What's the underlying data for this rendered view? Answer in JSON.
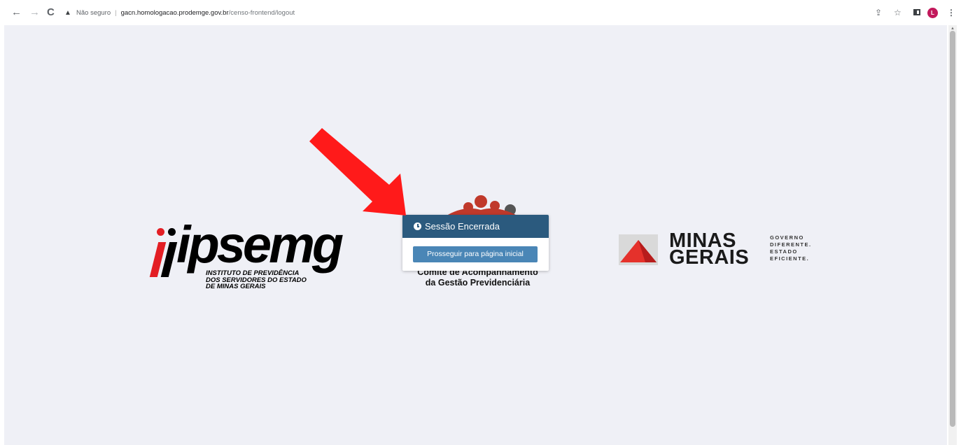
{
  "browser": {
    "security_label": "Não seguro",
    "url_host": "gacn.homologacao.prodemge.gov.br",
    "url_path": "/censo-frontend/logout",
    "profile_initial": "L",
    "profile_color": "#c2185b"
  },
  "ipsemg_logo": {
    "wordmark": "ipsemg",
    "subtitle_line1": "INSTITUTO DE PREVIDÊNCIA",
    "subtitle_line2": "DOS SERVIDORES DO ESTADO",
    "subtitle_line3": "DE MINAS GERAIS",
    "accent_color": "#e31e24"
  },
  "center_logo": {
    "line1": "Comitê de Acompanhamento",
    "line2": "da Gestão Previdenciária"
  },
  "mg_logo": {
    "word1": "MINAS",
    "word2": "GERAIS",
    "tag1": "GOVERNO",
    "tag2": "DIFERENTE.",
    "tag3": "ESTADO",
    "tag4": "EFICIENTE.",
    "accent_color": "#e5312b"
  },
  "modal": {
    "title": "Sessão Encerrada",
    "icon": "clock-icon",
    "button_label": "Prosseguir para página inicial",
    "header_color": "#2b5a7e",
    "button_color": "#4a86b6"
  },
  "annotation": {
    "arrow_color": "#ff1a1a"
  }
}
